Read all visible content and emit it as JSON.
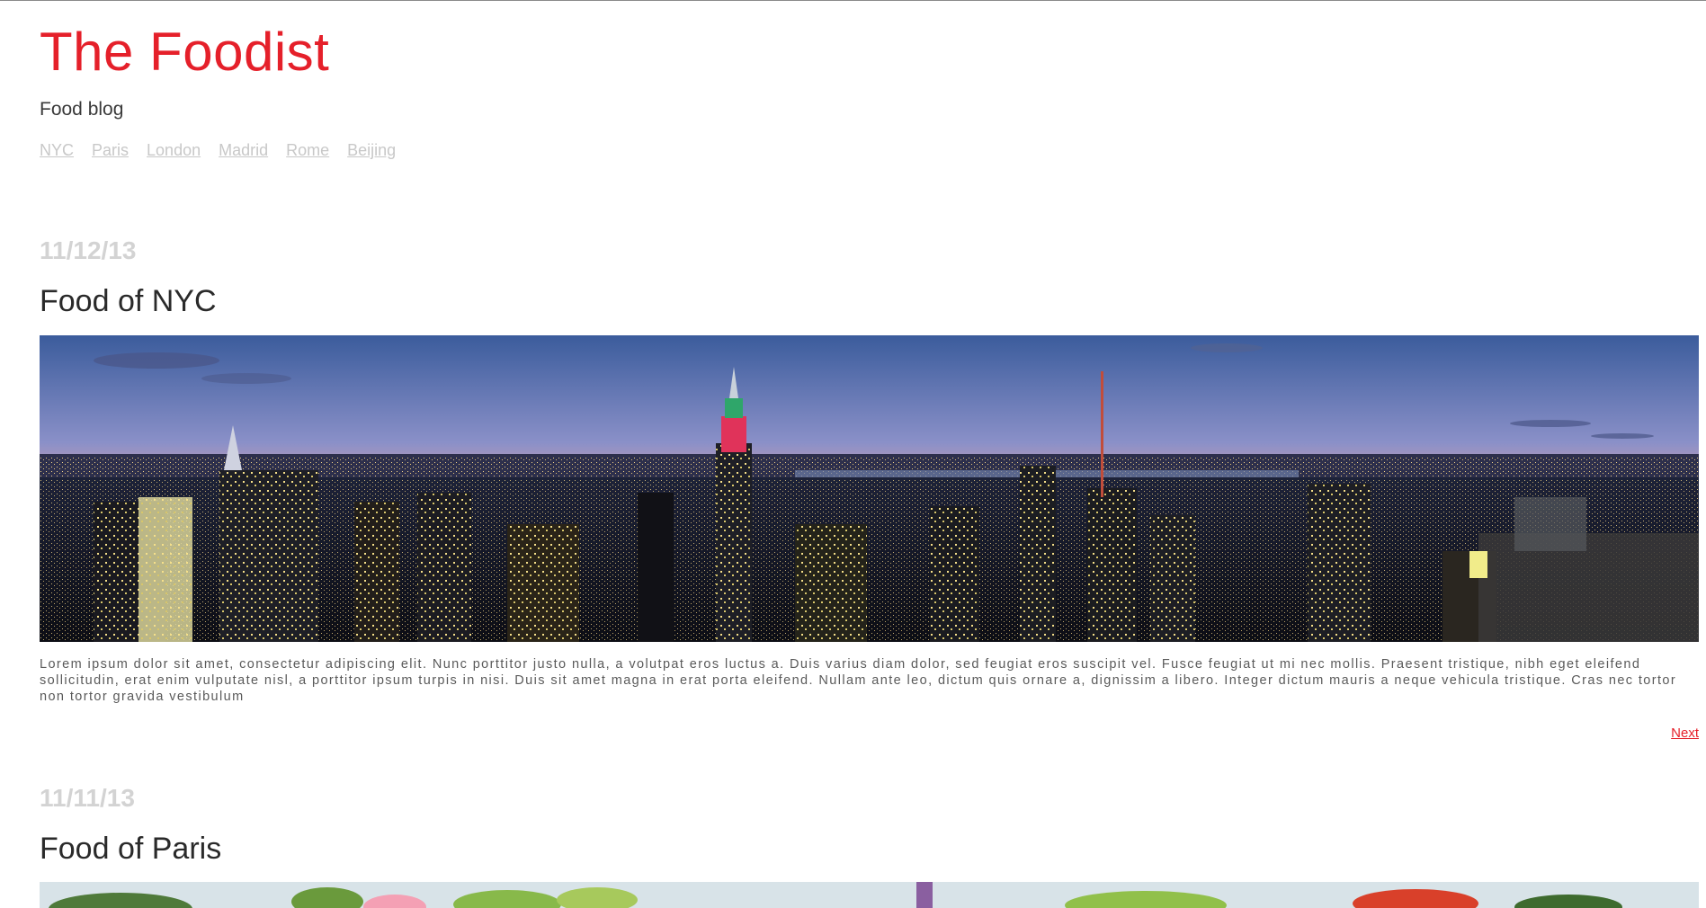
{
  "site": {
    "title": "The Foodist",
    "tagline": "Food blog"
  },
  "nav": {
    "items": [
      "NYC",
      "Paris",
      "London",
      "Madrid",
      "Rome",
      "Beijing"
    ]
  },
  "posts": [
    {
      "date": "11/12/13",
      "title": "Food of NYC",
      "body": "Lorem ipsum dolor sit amet, consectetur adipiscing elit. Nunc porttitor justo nulla, a volutpat eros luctus a. Duis varius diam dolor, sed feugiat eros suscipit vel. Fusce feugiat ut mi nec mollis. Praesent tristique, nibh eget eleifend sollicitudin, erat enim vulputate nisl, a porttitor ipsum turpis in nisi. Duis sit amet magna in erat porta eleifend. Nullam ante leo, dictum quis ornare a, dignissim a libero. Integer dictum mauris a neque vehicula tristique. Cras nec tortor non tortor gravida vestibulum",
      "next_label": "Next",
      "image": "nyc-skyline-panorama"
    },
    {
      "date": "11/11/13",
      "title": "Food of Paris",
      "image": "paris-food-illustration"
    }
  ],
  "colors": {
    "brand_red": "#e5202a",
    "date_gray": "#d3d3d3",
    "nav_gray": "#c8c8c8"
  }
}
